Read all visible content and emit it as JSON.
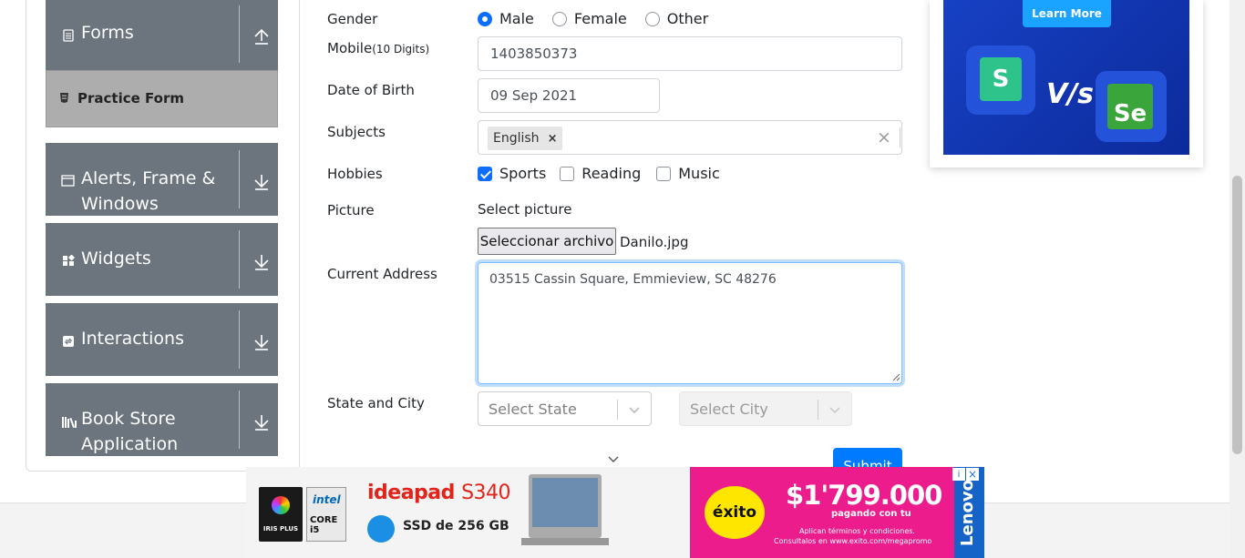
{
  "sidebar": {
    "groups": [
      {
        "label": "Forms",
        "icon": "document-icon",
        "expanded": true
      },
      {
        "label": "Alerts, Frame &",
        "label2": "Windows",
        "icon": "window-icon"
      },
      {
        "label": "Widgets",
        "icon": "widgets-icon"
      },
      {
        "label": "Interactions",
        "icon": "interactions-icon"
      },
      {
        "label": "Book Store",
        "label2": "Application",
        "icon": "books-icon"
      }
    ],
    "active_item": "Practice Form"
  },
  "form": {
    "gender": {
      "label": "Gender",
      "options": [
        "Male",
        "Female",
        "Other"
      ],
      "selected": "Male"
    },
    "mobile": {
      "label": "Mobile",
      "hint": "(10 Digits)",
      "value": "1403850373"
    },
    "dob": {
      "label": "Date of Birth",
      "value": "09 Sep 2021"
    },
    "subjects": {
      "label": "Subjects",
      "tags": [
        "English"
      ],
      "clear_glyph": "×",
      "remove_glyph": "×"
    },
    "hobbies": {
      "label": "Hobbies",
      "options": [
        "Sports",
        "Reading",
        "Music"
      ],
      "checked": [
        "Sports"
      ]
    },
    "picture": {
      "label": "Picture",
      "prompt": "Select picture",
      "button": "Seleccionar archivo",
      "file": "Danilo.jpg"
    },
    "address": {
      "label": "Current Address",
      "value": "03515 Cassin Square, Emmieview, SC 48276"
    },
    "state_city": {
      "label": "State and City",
      "state_placeholder": "Select State",
      "city_placeholder": "Select City"
    },
    "submit": "Submit"
  },
  "ad_right": {
    "button": "Learn More",
    "vs_text": "V/s",
    "logo_left": "S",
    "logo_right": "Se"
  },
  "ad_bottom": {
    "brand": "ideapad",
    "model": "S340",
    "storage": "SSD de 256 GB",
    "badge1_top": "IRIS PLUS",
    "badge2_brand": "intel",
    "badge2_line": "CORE i5",
    "store": "éxito",
    "price": "$1'799.000",
    "price_caption": "pagando con tu",
    "terms": "Aplican términos y condiciones.",
    "terms2": "Consultalos en www.exito.com/megapromo",
    "vertical_brand": "Lenovo"
  },
  "colors": {
    "sidebar_bg": "#6c757d",
    "active_bg": "#adadad",
    "primary": "#007bff",
    "ad_pink": "#ec1c8c",
    "ad_blue": "#1741c4"
  }
}
